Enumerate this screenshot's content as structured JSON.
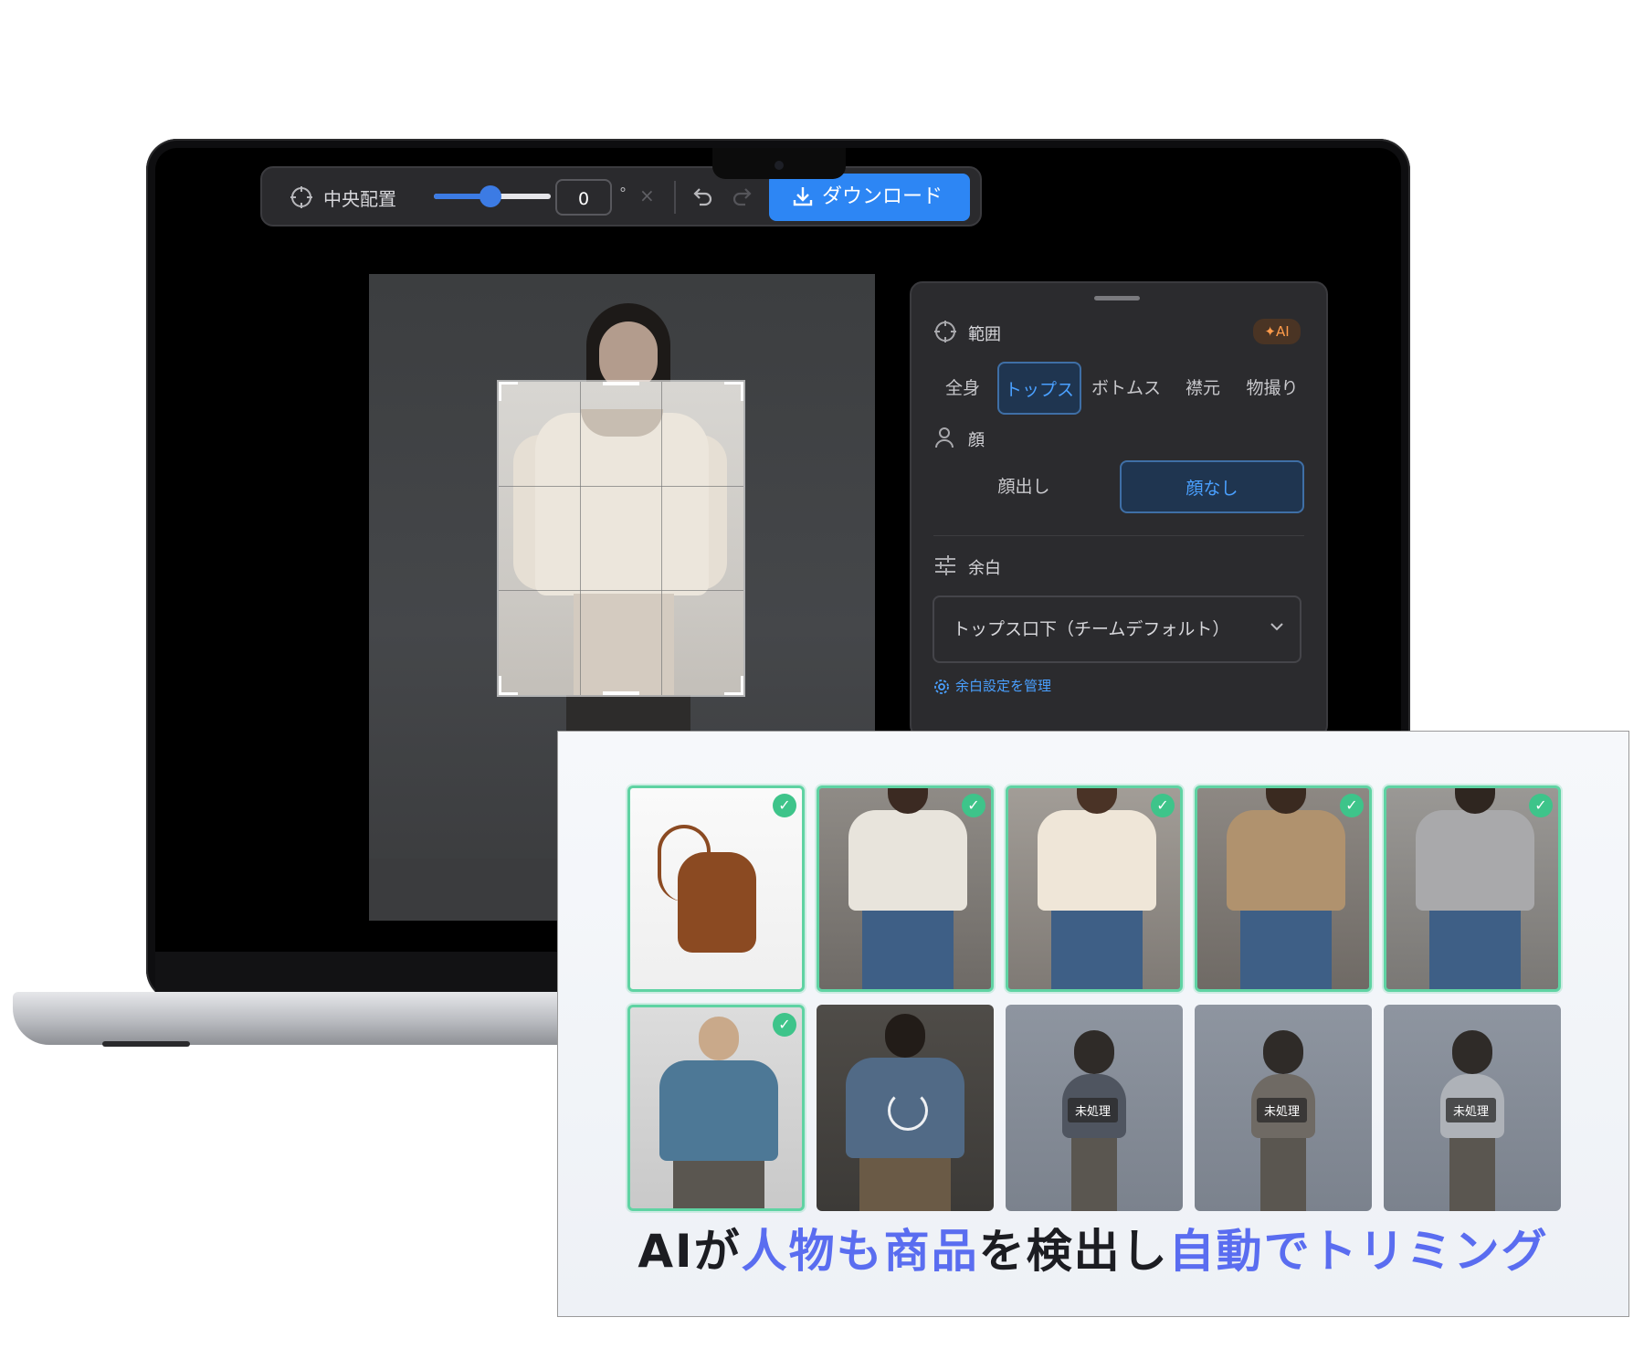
{
  "toolbar": {
    "center_label": "中央配置",
    "rotation_value": "0",
    "degree_unit": "°",
    "clear_symbol": "×",
    "download_label": "ダウンロード",
    "slider_level": 0.5
  },
  "panel": {
    "range_label": "範囲",
    "ai_badge": "AI",
    "range_options": [
      "全身",
      "トップス",
      "ボトムス",
      "襟元",
      "物撮り"
    ],
    "range_selected": "トップス",
    "face_label": "顔",
    "face_options": [
      "顔出し",
      "顔なし"
    ],
    "face_selected": "顔なし",
    "margin_label": "余白",
    "margin_select_value": "トップス口下（チームデフォルト）",
    "manage_link": "余白設定を管理"
  },
  "gallery": {
    "tiles": [
      {
        "subject": "leather bucket bag",
        "status": "done"
      },
      {
        "subject": "graphic tee",
        "status": "done"
      },
      {
        "subject": "knit top",
        "status": "done"
      },
      {
        "subject": "cropped sweater",
        "status": "done"
      },
      {
        "subject": "gray hoodie",
        "status": "done"
      },
      {
        "subject": "blue hoodie back",
        "status": "done"
      },
      {
        "subject": "denim jacket",
        "status": "processing"
      },
      {
        "subject": "full body outfit",
        "status": "unprocessed"
      },
      {
        "subject": "long skirt outfit",
        "status": "unprocessed"
      },
      {
        "subject": "hoodie back outfit",
        "status": "unprocessed"
      }
    ],
    "unprocessed_label": "未処理"
  },
  "tagline": {
    "part1": "AIが",
    "part2": "人物も商品",
    "part3": "を検出し",
    "part4": "自動でトリミング"
  },
  "colors": {
    "accent_blue": "#2d86f4",
    "done_green": "#3ec48a",
    "tagline_blue": "#5a6df0"
  }
}
